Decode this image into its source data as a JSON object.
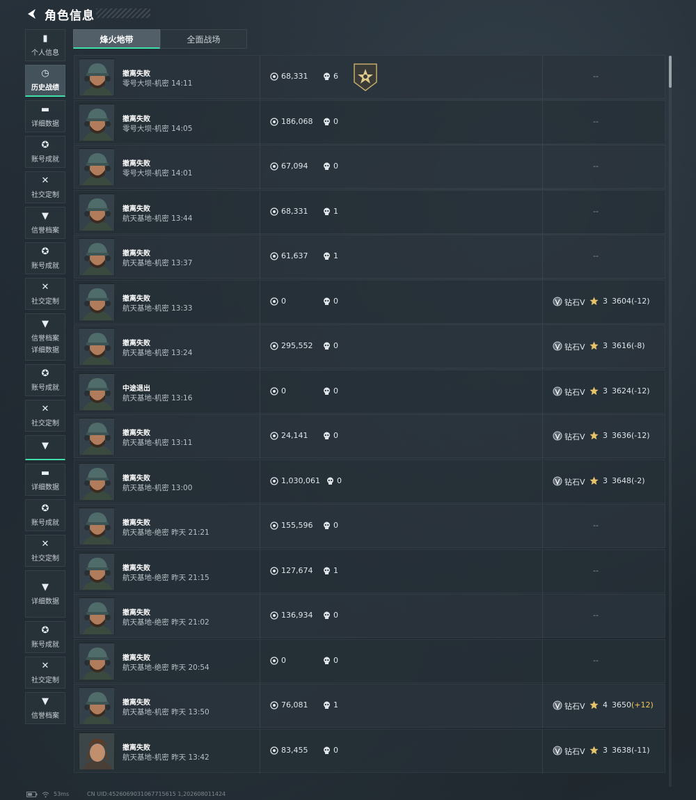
{
  "header": {
    "title": "角色信息"
  },
  "sidebar": {
    "items": [
      {
        "label": "个人信息",
        "icon": "bar-chart-icon",
        "glyph": "▮",
        "style": "",
        "active": false
      },
      {
        "label": "历史战绩",
        "icon": "clock-icon",
        "glyph": "◷",
        "style": "active",
        "active": true
      },
      {
        "label": "详细数据",
        "icon": "folder-icon",
        "glyph": "▬",
        "style": "",
        "active": false
      },
      {
        "label": "账号成就",
        "icon": "medal-icon",
        "glyph": "✪",
        "style": "",
        "active": false
      },
      {
        "label": "社交定制",
        "icon": "tools-icon",
        "glyph": "✕",
        "style": "",
        "active": false
      },
      {
        "label": "信誉档案",
        "icon": "shield-icon",
        "glyph": "▼",
        "style": "",
        "active": false
      },
      {
        "label": "账号成就",
        "icon": "medal-icon",
        "glyph": "✪",
        "style": "",
        "active": false
      },
      {
        "label": "社交定制",
        "icon": "tools-icon",
        "glyph": "✕",
        "style": "",
        "active": false
      },
      {
        "label": "信誉档案",
        "label2": "详细数据",
        "icon": "shield-icon",
        "glyph": "▼",
        "style": "tall",
        "active": false
      },
      {
        "label": "账号成就",
        "icon": "medal-icon",
        "glyph": "✪",
        "style": "",
        "active": false
      },
      {
        "label": "社交定制",
        "icon": "tools-icon",
        "glyph": "✕",
        "style": "",
        "active": false
      },
      {
        "label": "",
        "icon": "shield-icon",
        "glyph": "▼",
        "style": "short accent",
        "active": false
      },
      {
        "label": "详细数据",
        "icon": "folder-icon",
        "glyph": "▬",
        "style": "",
        "active": false
      },
      {
        "label": "账号成就",
        "icon": "medal-icon",
        "glyph": "✪",
        "style": "",
        "active": false
      },
      {
        "label": "社交定制",
        "icon": "tools-icon",
        "glyph": "✕",
        "style": "",
        "active": false
      },
      {
        "label": "详细数据",
        "icon": "shield-icon",
        "glyph": "▼",
        "style": "tall",
        "active": false
      },
      {
        "label": "账号成就",
        "icon": "medal-icon",
        "glyph": "✪",
        "style": "",
        "active": false
      },
      {
        "label": "社交定制",
        "icon": "tools-icon",
        "glyph": "✕",
        "style": "",
        "active": false
      },
      {
        "label": "信誉档案",
        "icon": "shield-icon",
        "glyph": "▼",
        "style": "",
        "active": false
      }
    ]
  },
  "tabs": [
    {
      "label": "烽火地带",
      "active": true
    },
    {
      "label": "全面战场",
      "active": false
    }
  ],
  "matches": [
    {
      "result": "撤离失败",
      "map": "零号大坝-机密 14:11",
      "money": "68,331",
      "kills": "6",
      "badge": true,
      "ranked": false,
      "dash": "--"
    },
    {
      "result": "撤离失败",
      "map": "零号大坝-机密 14:05",
      "money": "186,068",
      "kills": "0",
      "badge": false,
      "ranked": false,
      "dash": "--"
    },
    {
      "result": "撤离失败",
      "map": "零号大坝-机密 14:01",
      "money": "67,094",
      "kills": "0",
      "badge": false,
      "ranked": false,
      "dash": "--"
    },
    {
      "result": "撤离失败",
      "map": "航天基地-机密 13:44",
      "money": "68,331",
      "kills": "1",
      "badge": false,
      "ranked": false,
      "dash": "--"
    },
    {
      "result": "撤离失败",
      "map": "航天基地-机密 13:37",
      "money": "61,637",
      "kills": "1",
      "badge": false,
      "ranked": false,
      "dash": "--"
    },
    {
      "result": "撤离失败",
      "map": "航天基地-机密 13:33",
      "money": "0",
      "kills": "0",
      "badge": false,
      "ranked": true,
      "rank": "钻石V",
      "stars": "3",
      "score": "3604",
      "delta": "(-12)",
      "deltaPositive": false
    },
    {
      "result": "撤离失败",
      "map": "航天基地-机密 13:24",
      "money": "295,552",
      "kills": "0",
      "badge": false,
      "ranked": true,
      "rank": "钻石V",
      "stars": "3",
      "score": "3616",
      "delta": "(-8)",
      "deltaPositive": false
    },
    {
      "result": "中途退出",
      "map": "航天基地-机密 13:16",
      "money": "0",
      "kills": "0",
      "badge": false,
      "ranked": true,
      "rank": "钻石V",
      "stars": "3",
      "score": "3624",
      "delta": "(-12)",
      "deltaPositive": false
    },
    {
      "result": "撤离失败",
      "map": "航天基地-机密 13:11",
      "money": "24,141",
      "kills": "0",
      "badge": false,
      "ranked": true,
      "rank": "钻石V",
      "stars": "3",
      "score": "3636",
      "delta": "(-12)",
      "deltaPositive": false
    },
    {
      "result": "撤离失败",
      "map": "航天基地-机密 13:00",
      "money": "1,030,061",
      "kills": "0",
      "badge": false,
      "ranked": true,
      "rank": "钻石V",
      "stars": "3",
      "score": "3648",
      "delta": "(-2)",
      "deltaPositive": false
    },
    {
      "result": "撤离失败",
      "map": "航天基地-绝密 昨天 21:21",
      "money": "155,596",
      "kills": "0",
      "badge": false,
      "ranked": false,
      "dash": "--"
    },
    {
      "result": "撤离失败",
      "map": "航天基地-绝密 昨天 21:15",
      "money": "127,674",
      "kills": "1",
      "badge": false,
      "ranked": false,
      "dash": "--"
    },
    {
      "result": "撤离失败",
      "map": "航天基地-绝密 昨天 21:02",
      "money": "136,934",
      "kills": "0",
      "badge": false,
      "ranked": false,
      "dash": "--"
    },
    {
      "result": "撤离失败",
      "map": "航天基地-绝密 昨天 20:54",
      "money": "0",
      "kills": "0",
      "badge": false,
      "ranked": false,
      "dash": "--"
    },
    {
      "result": "撤离失败",
      "map": "航天基地-机密 昨天 13:50",
      "money": "76,081",
      "kills": "1",
      "badge": false,
      "ranked": true,
      "rank": "钻石V",
      "stars": "4",
      "score": "3650",
      "delta": "(+12)",
      "deltaPositive": true
    },
    {
      "result": "撤离失败",
      "map": "航天基地-机密 昨天 13:42",
      "money": "83,455",
      "kills": "0",
      "badge": false,
      "ranked": true,
      "rank": "钻石V",
      "stars": "3",
      "score": "3638",
      "delta": "(-11)",
      "deltaPositive": false,
      "altAvatar": true
    }
  ],
  "footer": {
    "ping": "53ms",
    "uid": "CN UID:4526069031067715615 1,202608011424"
  },
  "colors": {
    "accent": "#3fe0a8",
    "positive": "#f3c75c"
  }
}
